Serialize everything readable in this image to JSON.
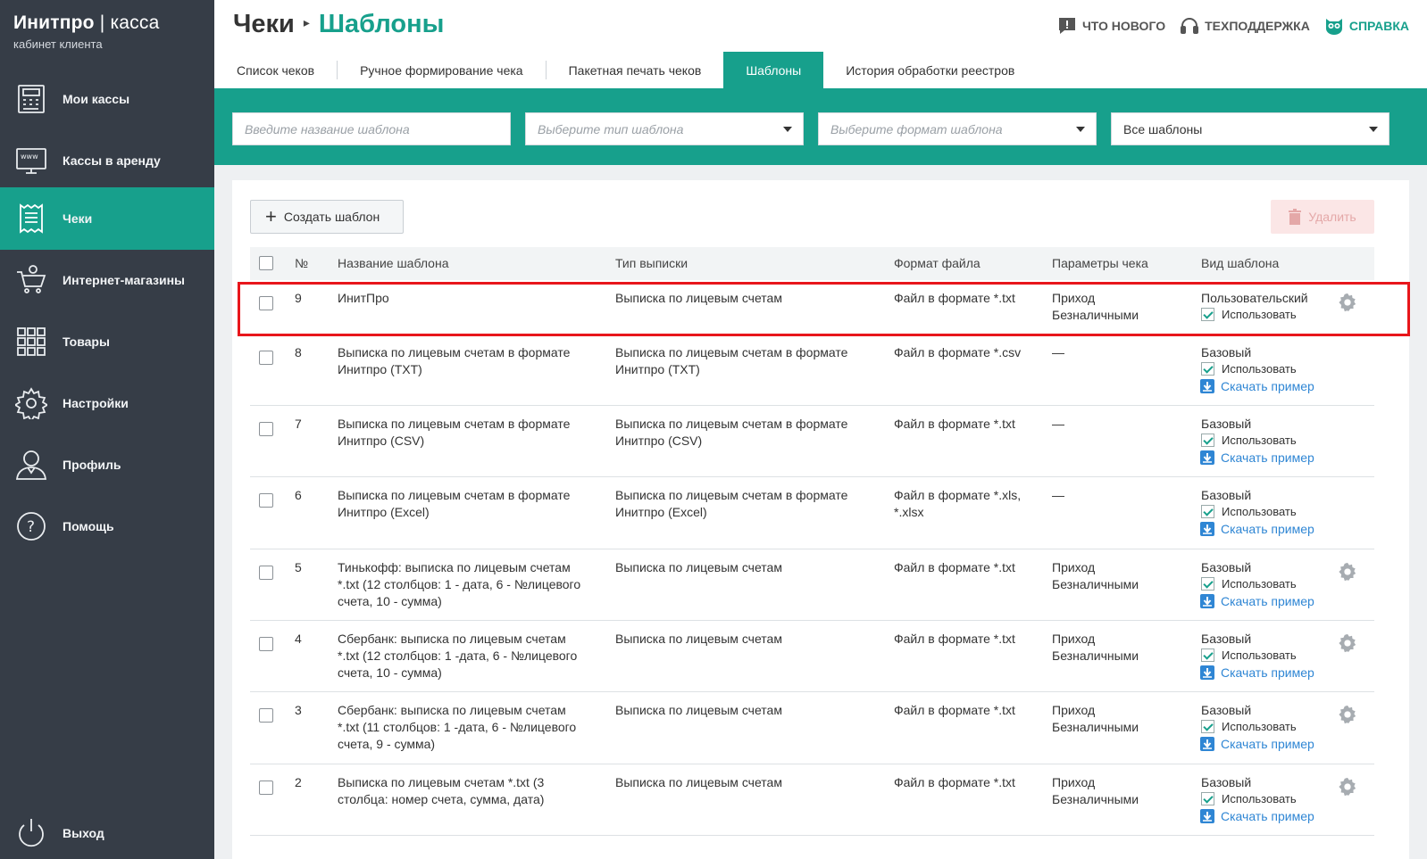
{
  "brand": {
    "title_bold": "Инитпро",
    "title_sep": " | ",
    "title_light": "касса",
    "subtitle": "кабинет клиента"
  },
  "sidebar": {
    "items": [
      {
        "label": "Мои кассы",
        "icon": "cash-register-icon"
      },
      {
        "label": "Кассы в аренду",
        "icon": "www-monitor-icon"
      },
      {
        "label": "Чеки",
        "icon": "receipt-icon",
        "active": true
      },
      {
        "label": "Интернет-магазины",
        "icon": "shopping-cart-icon"
      },
      {
        "label": "Товары",
        "icon": "grid-icon"
      },
      {
        "label": "Настройки",
        "icon": "gear-icon"
      },
      {
        "label": "Профиль",
        "icon": "user-icon"
      },
      {
        "label": "Помощь",
        "icon": "question-icon"
      }
    ],
    "logout": "Выход"
  },
  "header": {
    "crumb_parent": "Чеки",
    "crumb_sep": "▸",
    "crumb_current": "Шаблоны",
    "links": {
      "whats_new": "ЧТО НОВОГО",
      "support": "ТЕХПОДДЕРЖКА",
      "help": "СПРАВКА"
    }
  },
  "tabs": [
    "Список чеков",
    "Ручное формирование чека",
    "Пакетная печать чеков",
    "Шаблоны",
    "История обработки реестров"
  ],
  "filters": {
    "name_placeholder": "Введите название шаблона",
    "type_placeholder": "Выберите тип шаблона",
    "format_placeholder": "Выберите формат шаблона",
    "all_value": "Все шаблоны"
  },
  "actions": {
    "create": "Создать шаблон",
    "delete": "Удалить"
  },
  "table": {
    "headers": {
      "num": "№",
      "name": "Название шаблона",
      "type": "Тип выписки",
      "format": "Формат файла",
      "params": "Параметры чека",
      "kind": "Вид шаблона"
    },
    "use_label": "Использовать",
    "download_label": "Скачать пример",
    "rows": [
      {
        "num": "9",
        "name": [
          "ИнитПро"
        ],
        "type": [
          "Выписка по лицевым счетам"
        ],
        "format": [
          "Файл в формате *.txt"
        ],
        "params": [
          "Приход",
          "Безналичными"
        ],
        "kind": "Пользовательский",
        "download": false,
        "gear": true
      },
      {
        "num": "8",
        "name": [
          "Выписка по лицевым счетам в формате",
          "Инитпро (TXT)"
        ],
        "type": [
          "Выписка по лицевым счетам в формате",
          "Инитпро (TXT)"
        ],
        "format": [
          "Файл в формате *.csv"
        ],
        "params": [
          "—"
        ],
        "kind": "Базовый",
        "download": true,
        "gear": false
      },
      {
        "num": "7",
        "name": [
          "Выписка по лицевым счетам в формате",
          "Инитпро (CSV)"
        ],
        "type": [
          "Выписка по лицевым счетам в формате",
          "Инитпро (CSV)"
        ],
        "format": [
          "Файл в формате *.txt"
        ],
        "params": [
          "—"
        ],
        "kind": "Базовый",
        "download": true,
        "gear": false
      },
      {
        "num": "6",
        "name": [
          "Выписка по лицевым счетам в формате",
          "Инитпро (Excel)"
        ],
        "type": [
          "Выписка по лицевым счетам в формате",
          "Инитпро (Excel)"
        ],
        "format": [
          "Файл в формате *.xls,",
          "*.xlsx"
        ],
        "params": [
          "—"
        ],
        "kind": "Базовый",
        "download": true,
        "gear": false
      },
      {
        "num": "5",
        "name": [
          "Тинькофф: выписка по лицевым счетам",
          "*.txt (12 столбцов: 1 - дата, 6 - №лицевого",
          "счета, 10 - сумма)"
        ],
        "type": [
          "Выписка по лицевым счетам"
        ],
        "format": [
          "Файл в формате *.txt"
        ],
        "params": [
          "Приход",
          "Безналичными"
        ],
        "kind": "Базовый",
        "download": true,
        "gear": true
      },
      {
        "num": "4",
        "name": [
          "Сбербанк: выписка по лицевым счетам",
          "*.txt (12 столбцов: 1 -дата, 6 - №лицевого",
          "счета, 10 - сумма)"
        ],
        "type": [
          "Выписка по лицевым счетам"
        ],
        "format": [
          "Файл в формате *.txt"
        ],
        "params": [
          "Приход",
          "Безналичными"
        ],
        "kind": "Базовый",
        "download": true,
        "gear": true
      },
      {
        "num": "3",
        "name": [
          "Сбербанк: выписка по лицевым счетам",
          "*.txt (11 столбцов: 1 -дата, 6 - №лицевого",
          "счета, 9 - сумма)"
        ],
        "type": [
          "Выписка по лицевым счетам"
        ],
        "format": [
          "Файл в формате *.txt"
        ],
        "params": [
          "Приход",
          "Безналичными"
        ],
        "kind": "Базовый",
        "download": true,
        "gear": true
      },
      {
        "num": "2",
        "name": [
          "Выписка по лицевым счетам *.txt (3",
          "столбца: номер счета, сумма, дата)"
        ],
        "type": [
          "Выписка по лицевым счетам"
        ],
        "format": [
          "Файл в формате *.txt"
        ],
        "params": [
          "Приход",
          "Безналичными"
        ],
        "kind": "Базовый",
        "download": true,
        "gear": true
      }
    ]
  },
  "colors": {
    "accent": "#17a08c",
    "sidebar": "#363d47",
    "highlight": "#e8161b",
    "link": "#2f86d4"
  }
}
